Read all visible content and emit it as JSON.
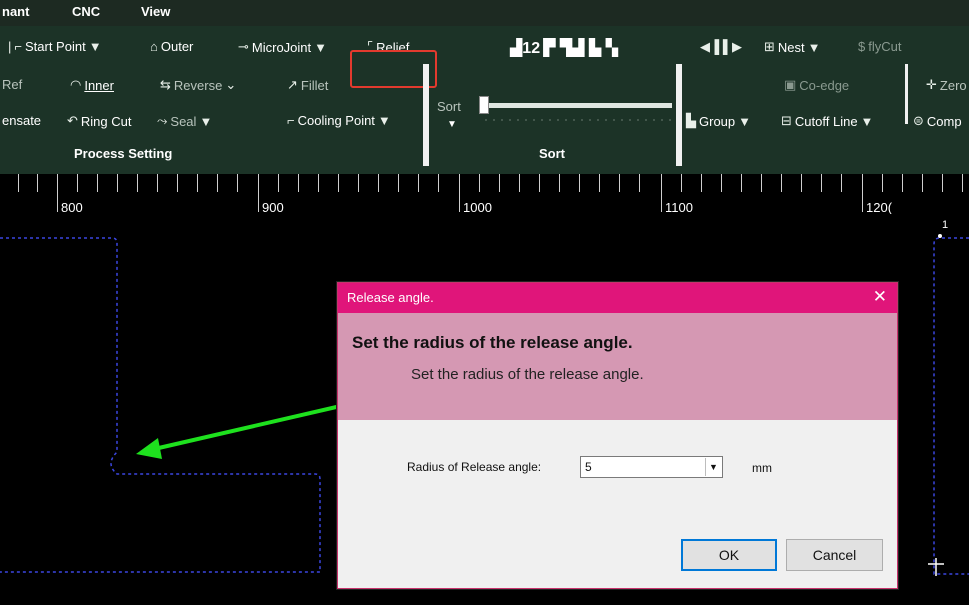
{
  "menu": {
    "items": [
      "nant",
      "CNC",
      "View"
    ]
  },
  "ribbon": {
    "row1": {
      "start_point": "Start Point",
      "outer": "Outer",
      "microjoint": "MicroJoint",
      "relief": "Relief",
      "nest": "Nest",
      "flycut": "flyCut"
    },
    "row2": {
      "ref": "Ref",
      "inner": "Inner",
      "reverse": "Reverse",
      "fillet": "Fillet",
      "sort": "Sort",
      "co_edge": "Co-edge",
      "zero": "Zero"
    },
    "row3": {
      "compensate": "ensate",
      "ring_cut": "Ring Cut",
      "seal": "Seal",
      "cooling_point": "Cooling Point",
      "group": "Group",
      "cutoff_line": "Cutoff Line",
      "comp": "Comp"
    },
    "groups": {
      "process_setting": "Process Setting",
      "sort": "Sort"
    }
  },
  "ruler": {
    "labels": [
      "800",
      "900",
      "1000",
      "1100",
      "120("
    ]
  },
  "canvas": {
    "part_number": "1"
  },
  "dialog": {
    "title": "Release angle.",
    "heading": "Set the radius of the release angle.",
    "subtext": "Set the radius of the release angle.",
    "field_label": "Radius of Release angle:",
    "field_value": "5",
    "unit": "mm",
    "ok_label": "OK",
    "cancel_label": "Cancel"
  },
  "colors": {
    "dialog_titlebar": "#e0157a",
    "dialog_header": "#d598b3",
    "ribbon_bg": "#1c3327",
    "highlight": "#e23a2e",
    "arrow": "#1ee11e",
    "contour": "#3b46e0"
  }
}
